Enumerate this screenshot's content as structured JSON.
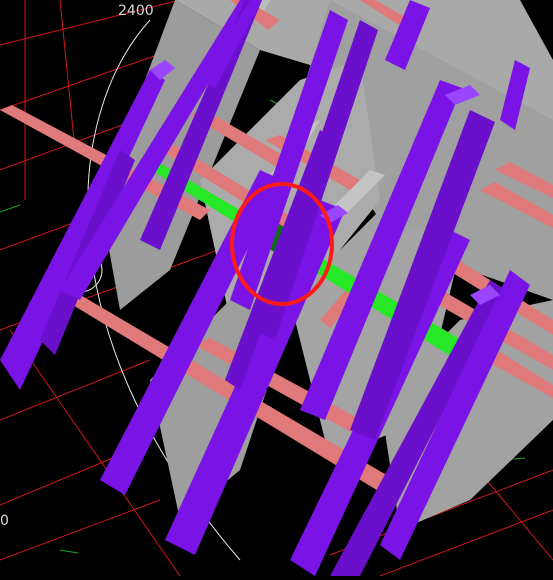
{
  "viewport": {
    "background": "#000000",
    "colors": {
      "grid_red": "#d01818",
      "grid_green": "#1aa51a",
      "wall_gray": "#a9a9a9",
      "wall_gray_light": "#bcbcbc",
      "column_purple": "#7a14e6",
      "column_purple_light": "#9a46ff",
      "beam_salmon": "#e07a7a",
      "beam_green": "#27e827",
      "beam_green_dark": "#0f6e12",
      "highlight_circle": "#ff1a1a"
    }
  },
  "dimension_labels": {
    "top": "2400",
    "left": "0"
  },
  "highlight": {
    "label": "highlighted-element-circle",
    "shape": "circle"
  }
}
